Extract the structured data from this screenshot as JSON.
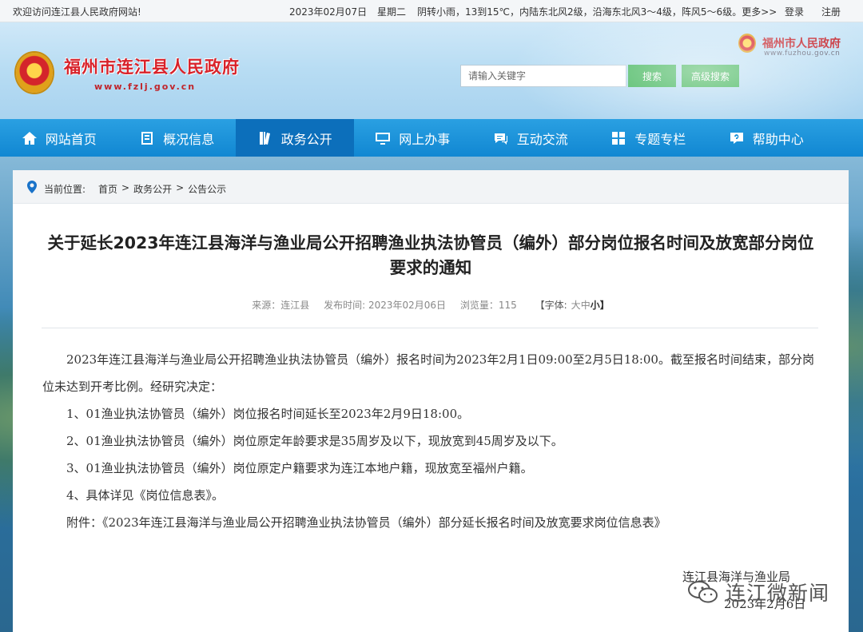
{
  "topbar": {
    "welcome": "欢迎访问连江县人民政府网站!",
    "date": "2023年02月07日",
    "weekday": "星期二",
    "weather": "阴转小雨，13到15℃，内陆东北风2级，沿海东北风3～4级，阵风5～6级。更多>>",
    "login": "登录",
    "register": "注册"
  },
  "header": {
    "site_title": "福州市连江县人民政府",
    "site_url": "www.fzlj.gov.cn",
    "city_title": "福州市人民政府",
    "city_url": "www.fuzhou.gov.cn",
    "search_placeholder": "请输入关键字",
    "search_button": "搜索",
    "advanced_search_button": "高级搜索"
  },
  "nav": {
    "items": [
      {
        "label": "网站首页",
        "icon": "home-icon"
      },
      {
        "label": "概况信息",
        "icon": "document-icon"
      },
      {
        "label": "政务公开",
        "icon": "book-icon"
      },
      {
        "label": "网上办事",
        "icon": "monitor-icon"
      },
      {
        "label": "互动交流",
        "icon": "chat-icon"
      },
      {
        "label": "专题专栏",
        "icon": "grid-icon"
      },
      {
        "label": "帮助中心",
        "icon": "help-icon"
      }
    ],
    "active_index": 2
  },
  "breadcrumb": {
    "label": "当前位置:",
    "path": [
      "首页",
      ">",
      "政务公开",
      ">",
      "公告公示"
    ]
  },
  "article": {
    "title": "关于延长2023年连江县海洋与渔业局公开招聘渔业执法协管员（编外）部分岗位报名时间及放宽部分岗位要求的通知",
    "source": "来源：连江县",
    "publish_time": "发布时间: 2023年02月06日",
    "views": "浏览量：115",
    "font_label": "【字体:",
    "font_large": "大",
    "font_medium": "中",
    "font_small": "小】",
    "paragraphs": [
      "2023年连江县海洋与渔业局公开招聘渔业执法协管员（编外）报名时间为2023年2月1日09:00至2月5日18:00。截至报名时间结束，部分岗位未达到开考比例。经研究决定：",
      "1、01渔业执法协管员（编外）岗位报名时间延长至2023年2月9日18:00。",
      "2、01渔业执法协管员（编外）岗位原定年龄要求是35周岁及以下，现放宽到45周岁及以下。",
      "3、01渔业执法协管员（编外）岗位原定户籍要求为连江本地户籍，现放宽至福州户籍。",
      "4、具体详见《岗位信息表》。",
      "附件：《2023年连江县海洋与渔业局公开招聘渔业执法协管员（编外）部分延长报名时间及放宽要求岗位信息表》"
    ],
    "signer": "连江县海洋与渔业局",
    "sign_date": "2023年2月6日"
  },
  "watermark": {
    "text": "连江微新闻",
    "icon": "wechat-icon"
  }
}
